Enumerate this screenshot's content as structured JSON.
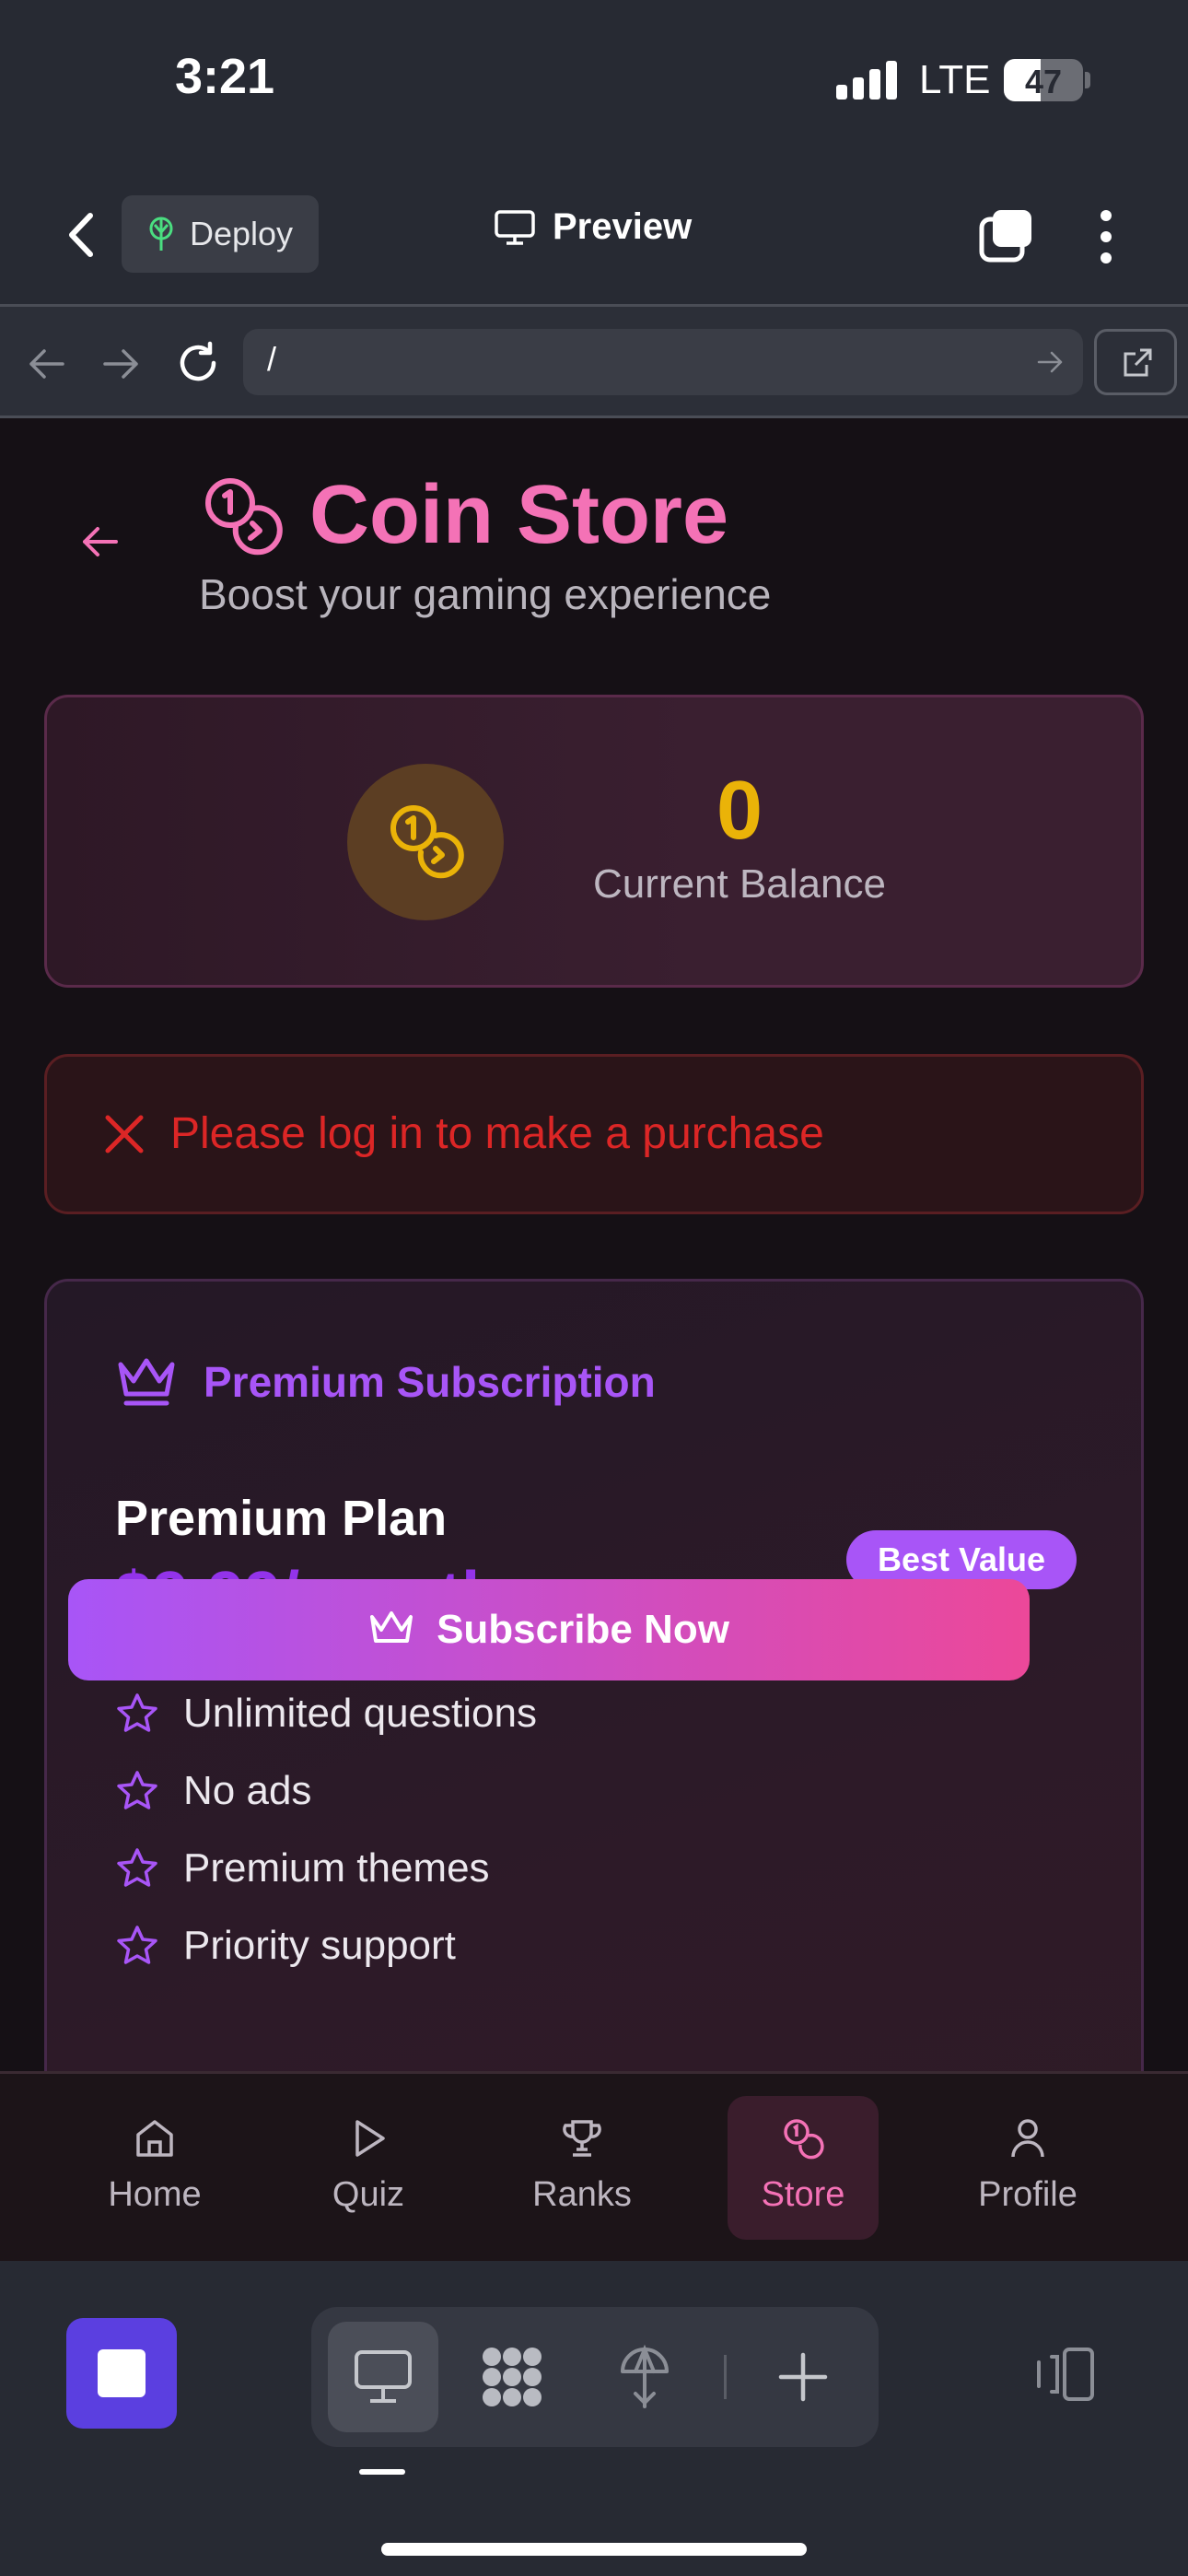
{
  "status": {
    "time": "3:21",
    "network": "LTE",
    "battery": "47",
    "battery_level": 0.47
  },
  "topbar": {
    "deploy_label": "Deploy",
    "preview_label": "Preview"
  },
  "urlbar": {
    "url": "/"
  },
  "header": {
    "title": "Coin Store",
    "subtitle": "Boost your gaming experience"
  },
  "balance": {
    "value": "0",
    "label": "Current Balance"
  },
  "error": {
    "message": "Please log in to make a purchase"
  },
  "premium": {
    "heading": "Premium Subscription",
    "plan_name": "Premium Plan",
    "price": "$9.99/month",
    "badge": "Best Value",
    "features": [
      "Unlimited questions",
      "No ads",
      "Premium themes",
      "Priority support"
    ],
    "subscribe_label": "Subscribe Now"
  },
  "nav": {
    "items": [
      {
        "label": "Home",
        "icon": "home-icon"
      },
      {
        "label": "Quiz",
        "icon": "play-icon"
      },
      {
        "label": "Ranks",
        "icon": "trophy-icon"
      },
      {
        "label": "Store",
        "icon": "coins-icon",
        "active": true
      },
      {
        "label": "Profile",
        "icon": "user-icon"
      }
    ]
  },
  "colors": {
    "accent_pink": "#f472b6",
    "accent_purple": "#a855f7",
    "coin_gold": "#eab308",
    "error_red": "#dc2626",
    "stop_purple": "#5b3fe0"
  }
}
